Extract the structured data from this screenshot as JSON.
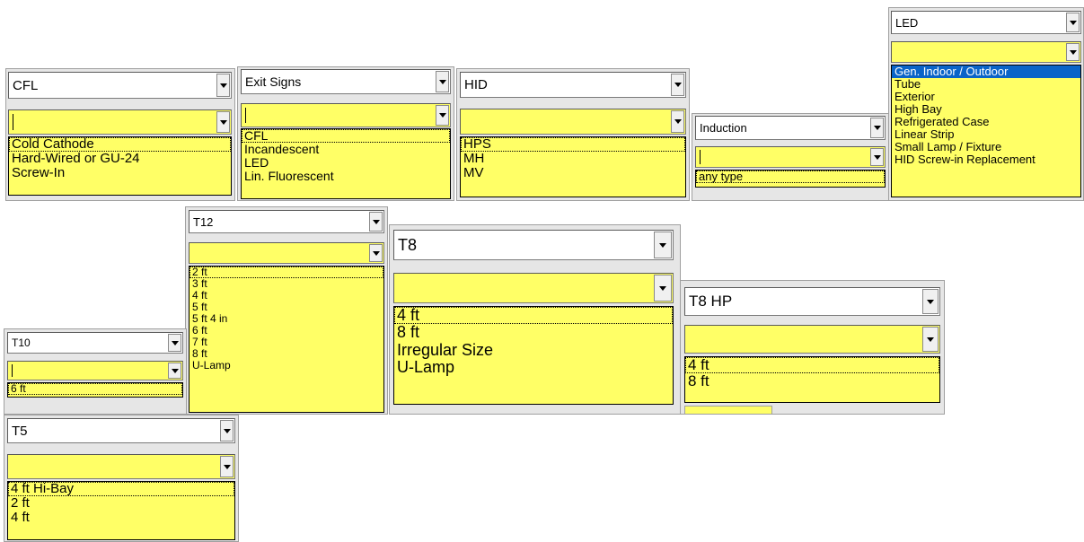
{
  "cfl": {
    "type_value": "CFL",
    "options": [
      "Cold Cathode",
      "Hard-Wired or GU-24",
      "Screw-In"
    ]
  },
  "exit": {
    "type_value": "Exit Signs",
    "options": [
      "CFL",
      "Incandescent",
      "LED",
      "Lin. Fluorescent"
    ]
  },
  "hid": {
    "type_value": "HID",
    "options": [
      "HPS",
      "MH",
      "MV"
    ]
  },
  "induction": {
    "type_value": "Induction",
    "options": [
      "any type"
    ]
  },
  "led": {
    "type_value": "LED",
    "options": [
      "Gen. Indoor / Outdoor",
      "Tube",
      "Exterior",
      "High Bay",
      "Refrigerated Case",
      "Linear Strip",
      "Small Lamp / Fixture",
      "HID Screw-in Replacement"
    ]
  },
  "t12": {
    "type_value": "T12",
    "options": [
      "2 ft",
      "3 ft",
      "4 ft",
      "5 ft",
      "5 ft 4 in",
      "6 ft",
      "7 ft",
      "8 ft",
      "U-Lamp"
    ]
  },
  "t8": {
    "type_value": "T8",
    "options": [
      "4 ft",
      "8 ft",
      "Irregular Size",
      "U-Lamp"
    ]
  },
  "t8hp": {
    "type_value": "T8 HP",
    "options": [
      "4 ft",
      "8 ft"
    ]
  },
  "t10": {
    "type_value": "T10",
    "options": [
      "6 ft"
    ]
  },
  "t5": {
    "type_value": "T5",
    "options": [
      "4 ft Hi-Bay",
      "2 ft",
      "4 ft"
    ]
  },
  "colors": {
    "field_yellow": "#ffff66",
    "highlight_blue": "#0a64c8"
  }
}
